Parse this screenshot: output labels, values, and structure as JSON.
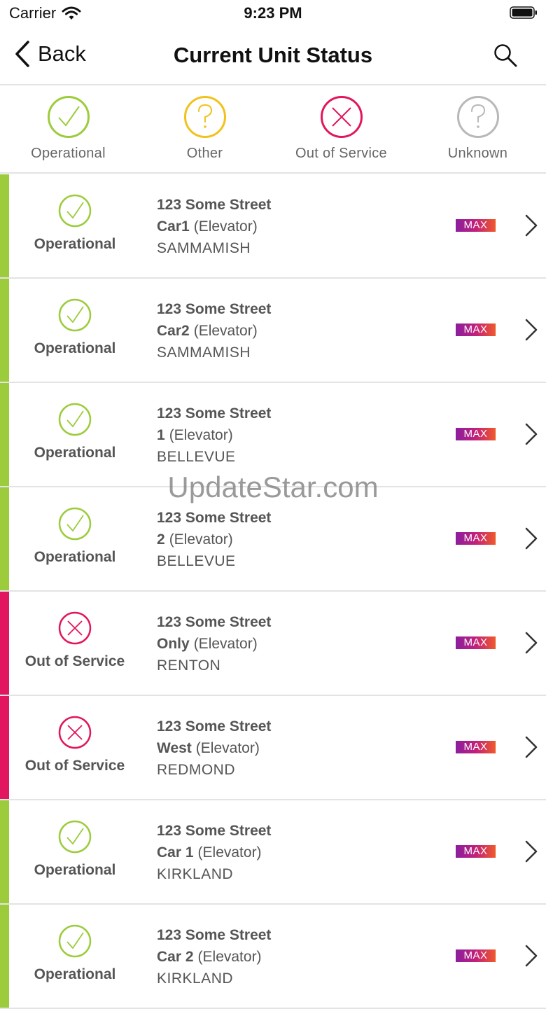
{
  "status_bar": {
    "carrier": "Carrier",
    "time": "9:23 PM"
  },
  "nav": {
    "back_label": "Back",
    "title": "Current Unit Status"
  },
  "legend": [
    {
      "label": "Operational",
      "icon": "check-circle-icon",
      "color": "#9ccc3c"
    },
    {
      "label": "Other",
      "icon": "question-circle-icon",
      "color": "#f2c21b"
    },
    {
      "label": "Out of Service",
      "icon": "x-circle-icon",
      "color": "#e2165e"
    },
    {
      "label": "Unknown",
      "icon": "question-circle-icon",
      "color": "#b8b8b8"
    }
  ],
  "colors": {
    "operational": "#9ccc3c",
    "out_of_service": "#e2165e"
  },
  "units": [
    {
      "status": "Operational",
      "street": "123 Some Street",
      "unit": "Car1",
      "type": "(Elevator)",
      "city": "SAMMAMISH",
      "badge": "MAX"
    },
    {
      "status": "Operational",
      "street": "123 Some Street",
      "unit": "Car2",
      "type": "(Elevator)",
      "city": "SAMMAMISH",
      "badge": "MAX"
    },
    {
      "status": "Operational",
      "street": "123 Some Street",
      "unit": "1",
      "type": "(Elevator)",
      "city": "BELLEVUE",
      "badge": "MAX"
    },
    {
      "status": "Operational",
      "street": "123 Some Street",
      "unit": "2",
      "type": "(Elevator)",
      "city": "BELLEVUE",
      "badge": "MAX"
    },
    {
      "status": "Out of Service",
      "street": "123 Some Street",
      "unit": "Only",
      "type": "(Elevator)",
      "city": "RENTON",
      "badge": "MAX"
    },
    {
      "status": "Out of Service",
      "street": "123 Some Street",
      "unit": "West",
      "type": "(Elevator)",
      "city": "REDMOND",
      "badge": "MAX"
    },
    {
      "status": "Operational",
      "street": "123 Some Street",
      "unit": "Car 1",
      "type": "(Elevator)",
      "city": "KIRKLAND",
      "badge": "MAX"
    },
    {
      "status": "Operational",
      "street": "123 Some Street",
      "unit": "Car 2",
      "type": "(Elevator)",
      "city": "KIRKLAND",
      "badge": "MAX"
    }
  ],
  "watermark": "UpdateStar.com"
}
